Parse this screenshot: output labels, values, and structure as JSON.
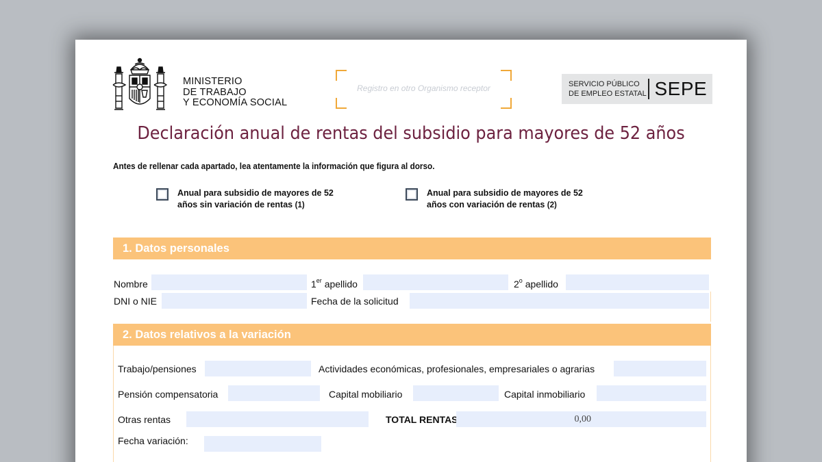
{
  "header": {
    "ministry_lines": [
      "MINISTERIO",
      "DE TRABAJO",
      "Y ECONOMÍA SOCIAL"
    ],
    "registry_placeholder": "Registro en otro Organismo receptor",
    "sepe_service_lines": [
      "SERVICIO PÚBLICO",
      "DE EMPLEO ESTATAL"
    ],
    "sepe_name": "SEPE"
  },
  "title": "Declaración anual de rentas del subsidio para mayores de 52 años",
  "instructions": "Antes de rellenar cada apartado, lea atentamente la información que figura al dorso.",
  "options": [
    {
      "line1": "Anual para subsidio de mayores de 52",
      "line2": "años sin variación de rentas",
      "note": "(1)"
    },
    {
      "line1": "Anual para subsidio de mayores de 52",
      "line2": "años con variación de rentas",
      "note": "(2)"
    }
  ],
  "section1": {
    "title": "1. Datos personales",
    "nombre_label": "Nombre",
    "apellido1_prefix": "1",
    "apellido1_sup": "er",
    "apellido1_suffix": " apellido",
    "apellido2_prefix": "2",
    "apellido2_sup": "o",
    "apellido2_suffix": " apellido",
    "dni_label": "DNI o NIE",
    "fecha_solicitud_label": "Fecha de la solicitud",
    "values": {
      "nombre": "",
      "apellido1": "",
      "apellido2": "",
      "dni": "",
      "fecha_solicitud": ""
    }
  },
  "section2": {
    "title": "2. Datos relativos a la variación",
    "trabajo_label": "Trabajo/pensiones",
    "actividades_label": "Actividades económicas, profesionales, empresariales o agrarias",
    "pension_label": "Pensión compensatoria",
    "capital_mob_label": "Capital mobiliario",
    "capital_inmob_label": "Capital inmobiliario",
    "otras_label": "Otras rentas",
    "total_label": "TOTAL RENTAS",
    "total_value": "0,00",
    "fecha_variacion_label": "Fecha variación:",
    "values": {
      "trabajo": "",
      "actividades": "",
      "pension": "",
      "capital_mob": "",
      "capital_inmob": "",
      "otras": "",
      "fecha_variacion": ""
    }
  },
  "colors": {
    "section_header_bg": "#fbc37a",
    "title_color": "#6d2240",
    "field_bg": "#e7eefc",
    "registry_corner": "#f0a838"
  }
}
